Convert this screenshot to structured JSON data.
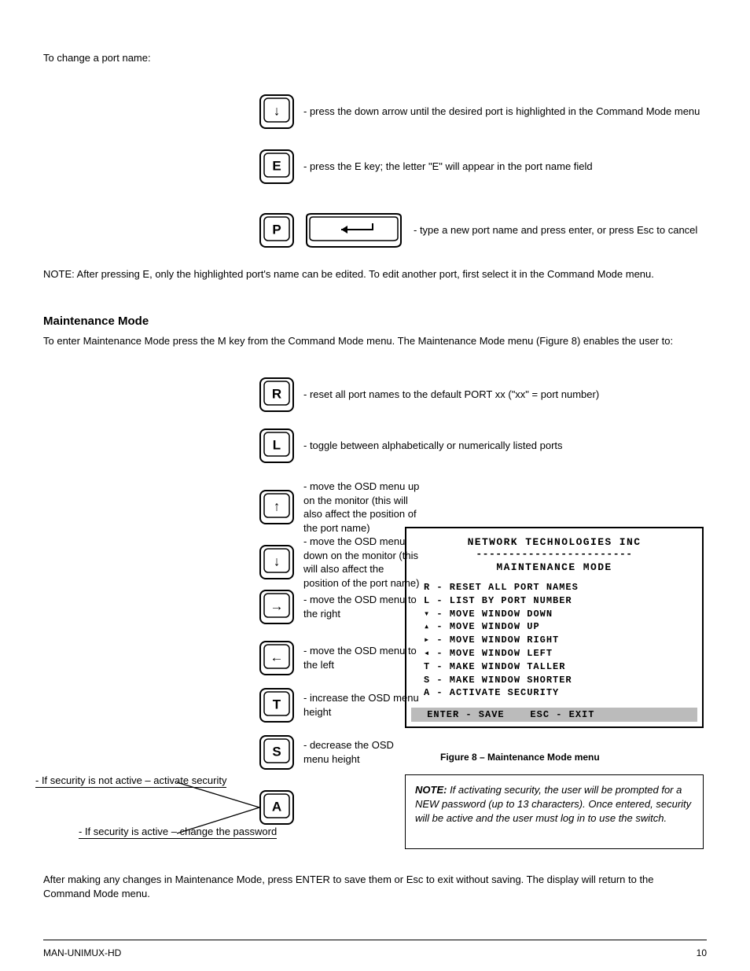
{
  "top": {
    "intro": "To change a port name:",
    "steps": [
      {
        "text": "- press the down arrow until the desired port is highlighted in the Command Mode menu"
      },
      {
        "text": "- press the E key; the letter \"E\" will appear in the port name field",
        "key": "E"
      },
      {
        "text": "- type a new port name and press enter, or press Esc to cancel",
        "key": "P",
        "has_enter": true
      }
    ],
    "after": "NOTE: After pressing E, only the highlighted port's name can be edited. To edit another port, first select it in the Command Mode menu."
  },
  "maint_heading": "Maintenance Mode",
  "maint_intro": "To enter Maintenance Mode press the M key from the Command Mode menu. The Maintenance Mode menu (Figure 8) enables the user to:",
  "rows": [
    {
      "key": "R",
      "text": "- reset all port names to the default PORT xx (\"xx\" = port number)"
    },
    {
      "key": "L",
      "text": "- toggle between alphabetically or numerically listed ports"
    },
    {
      "key": "↑",
      "text": "- move the OSD menu up on the monitor (this will also affect the position of the port name)"
    },
    {
      "key": "↓",
      "text": "- move the OSD menu down on the monitor (this will also affect the position of the port name)"
    },
    {
      "key": "→",
      "text": "- move the OSD menu to the right"
    },
    {
      "key": "←",
      "text": "- move the OSD menu to the left"
    },
    {
      "key": "T",
      "text": "- increase the OSD menu height"
    },
    {
      "key": "S",
      "text": "- decrease the OSD menu height"
    }
  ],
  "security": {
    "key": "A",
    "line1": "- If security is not active  – activate security",
    "line2": "- If security is active  – change the password"
  },
  "maint_box": {
    "title": "NETWORK TECHNOLOGIES INC",
    "dashes": "------------------------",
    "mode": "MAINTENANCE MODE",
    "items": [
      "R - RESET ALL PORT NAMES",
      "L - LIST BY PORT NUMBER",
      "▾ - MOVE WINDOW DOWN",
      "▴ - MOVE WINDOW UP",
      "▸ - MOVE WINDOW RIGHT",
      "◂ - MOVE WINDOW LEFT",
      "T - MAKE WINDOW TALLER",
      "S - MAKE WINDOW SHORTER",
      "A - ACTIVATE SECURITY"
    ],
    "footer": " ENTER - SAVE    ESC - EXIT"
  },
  "figure_caption": "Figure 8 – Maintenance Mode menu",
  "note": {
    "title": "NOTE: ",
    "body": "If activating security, the user will be prompted for a NEW password (up to 13 characters). Once entered, security will be active and the user must log in to use the switch."
  },
  "closing": "After making any changes in Maintenance Mode, press ENTER to save them or Esc to exit without saving. The display will return to the Command Mode menu.",
  "footer_left": "MAN-UNIMUX-HD",
  "footer_right": "10"
}
